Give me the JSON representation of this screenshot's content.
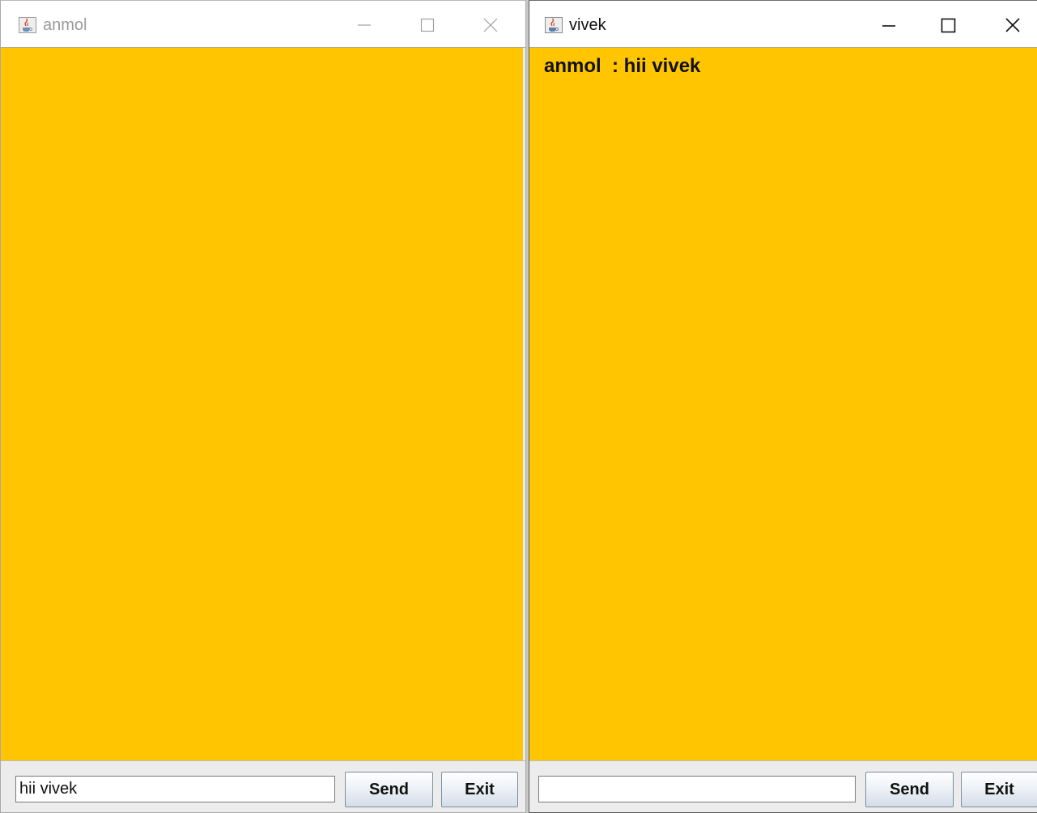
{
  "windows": [
    {
      "title": "anmol",
      "active": false,
      "messages": [],
      "input_value": "hii vivek",
      "send_label": "Send",
      "exit_label": "Exit"
    },
    {
      "title": "vivek",
      "active": true,
      "messages": [
        "anmol  : hii vivek"
      ],
      "input_value": "",
      "send_label": "Send",
      "exit_label": "Exit"
    }
  ],
  "icons": {
    "app": "java-coffee-cup-icon",
    "minimize": "minimize-icon",
    "maximize": "maximize-icon",
    "close": "close-icon"
  },
  "colors": {
    "chat_background": "#fec500",
    "title_inactive": "#9a9a9a",
    "title_active": "#111111"
  }
}
